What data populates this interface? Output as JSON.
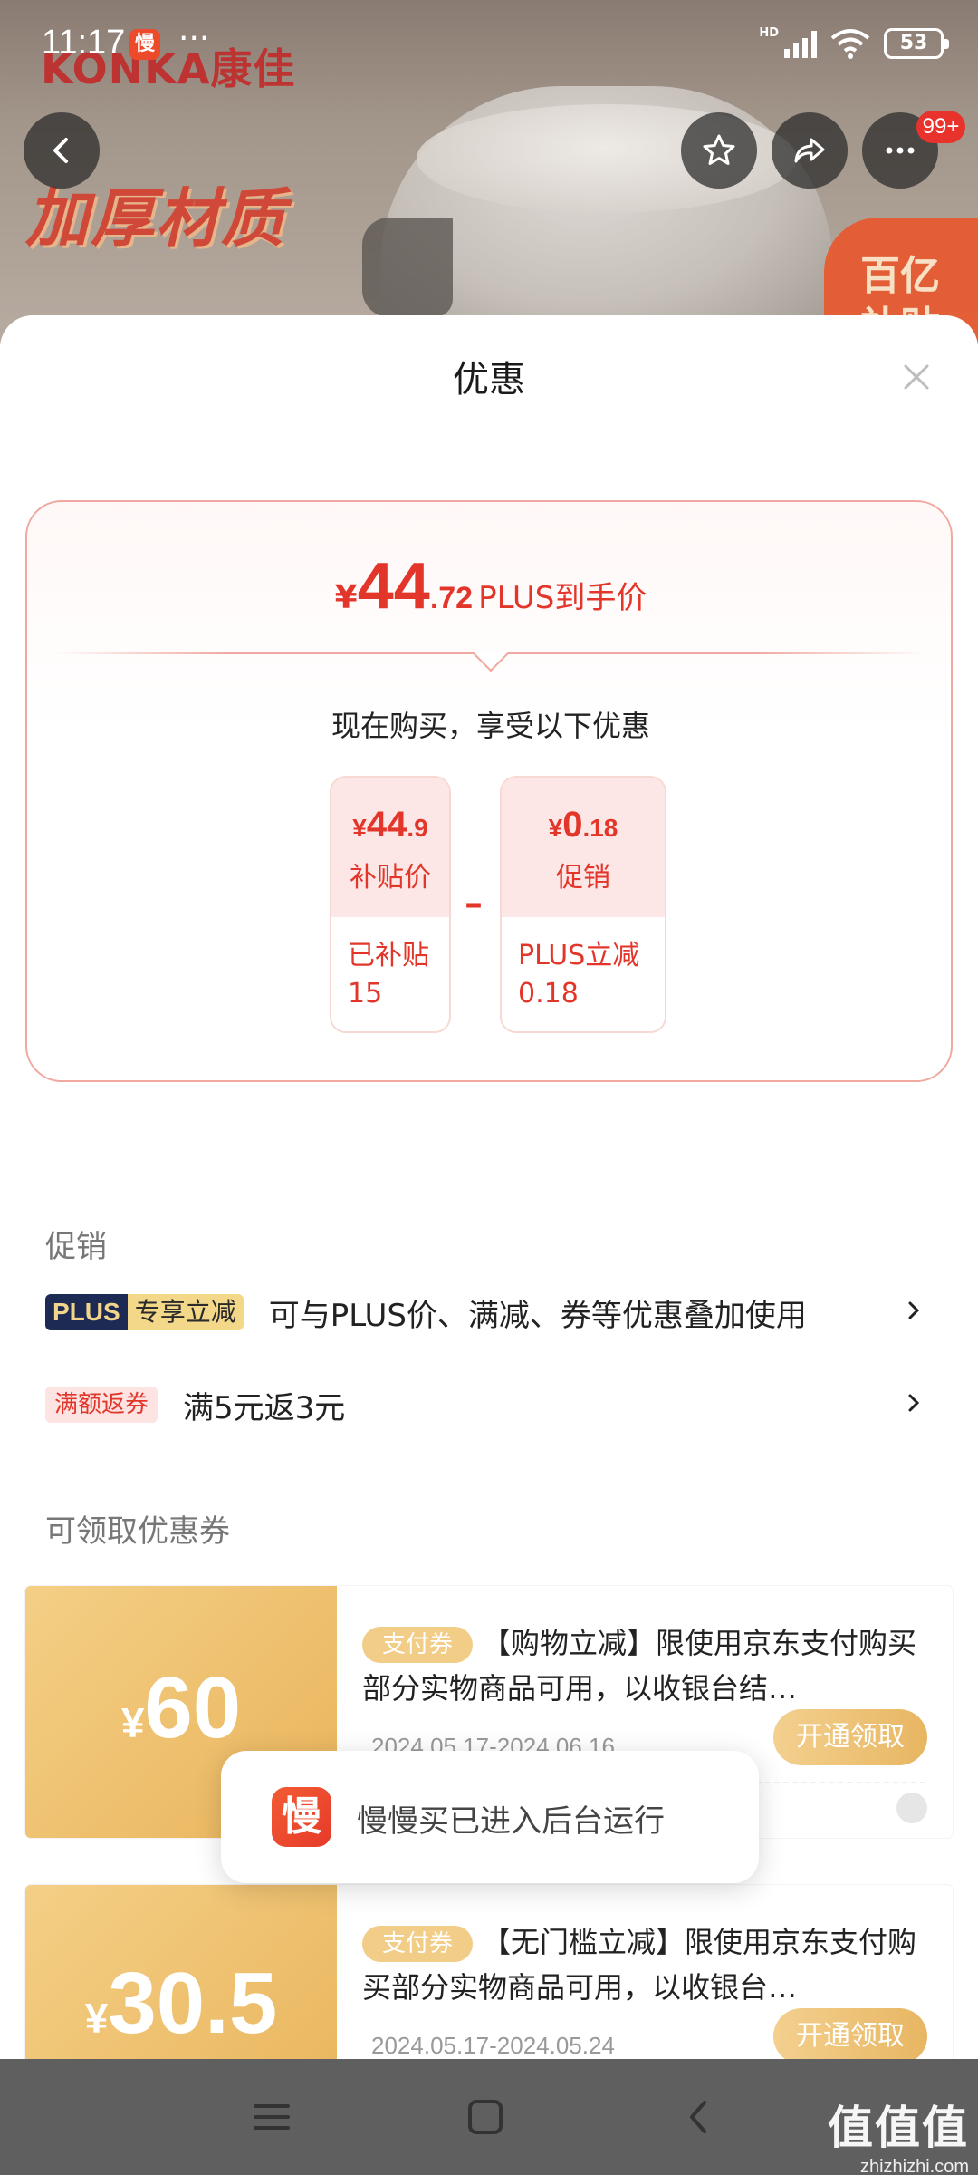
{
  "status_bar": {
    "time": "11:17",
    "app_icon_text": "慢",
    "more": "···",
    "network": "HD",
    "battery": "53"
  },
  "hero": {
    "brand": "KONKA康佳",
    "slogan": "加厚材质",
    "corner_badge_line1": "百亿",
    "corner_badge_line2": "补贴"
  },
  "top_nav": {
    "cart_badge": "99+"
  },
  "sheet": {
    "title": "优惠",
    "price": {
      "currency": "¥",
      "integer": "44",
      "decimal": ".72",
      "tag": "PLUS到手价"
    },
    "buy_now_text": "现在购买，享受以下优惠",
    "breakdown": [
      {
        "currency": "¥",
        "integer": "44",
        "decimal": ".9",
        "label": "补贴价",
        "detail_line1": "已补贴",
        "detail_line2": "15"
      },
      {
        "currency": "¥",
        "integer": "0",
        "decimal": ".18",
        "label": "促销",
        "detail_line1": "PLUS立减",
        "detail_line2": "0.18"
      }
    ],
    "minus_sign": "–",
    "promo_section_title": "促销",
    "promos": [
      {
        "badge_part1": "PLUS",
        "badge_part2": "专享立减",
        "text": "可与PLUS价、满减、券等优惠叠加使用"
      },
      {
        "badge": "满额返券",
        "text": "满5元返3元"
      }
    ],
    "coupon_section_title": "可领取优惠券",
    "coupons": [
      {
        "currency": "¥",
        "value": "60",
        "tag": "支付券",
        "desc": "【购物立减】限使用京东支付购买部分实物商品可用，以收银台结…",
        "date": "2024.05.17-2024.06.16",
        "button": "开通领取"
      },
      {
        "currency": "¥",
        "value": "30.5",
        "tag": "支付券",
        "desc": "【无门槛立减】限使用京东支付购买部分实物商品可用，以收银台…",
        "date": "2024.05.17-2024.05.24",
        "button": "开通领取"
      }
    ]
  },
  "toast": {
    "icon_text": "慢",
    "message": "慢慢买已进入后台运行"
  },
  "watermark": {
    "line1": "值值值",
    "line2": "zhizhizhi.com"
  },
  "colors": {
    "accent_red": "#e3362b",
    "coupon_gold": "#e9b45b",
    "plus_navy": "#1c2a54"
  }
}
